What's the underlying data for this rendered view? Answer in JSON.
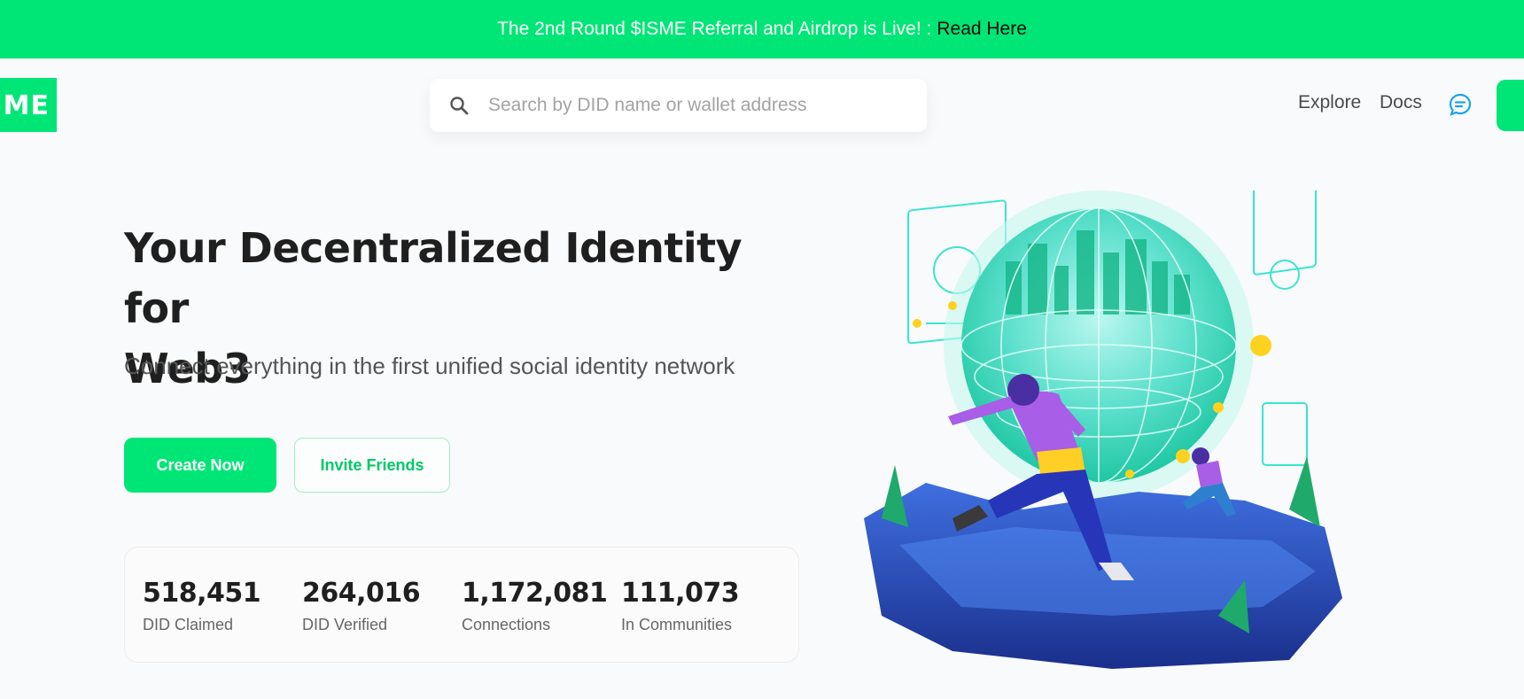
{
  "banner": {
    "text": "The 2nd Round $ISME Referral and Airdrop is Live! :",
    "link": "Read Here"
  },
  "logo": {
    "text": "ME"
  },
  "search": {
    "placeholder": "Search by DID name or wallet address"
  },
  "nav": {
    "explore": "Explore",
    "docs": "Docs"
  },
  "hero": {
    "title_line1": "Your Decentralized Identity for",
    "title_line2": "Web3",
    "subtitle": "Connect everything in the first unified social identity network"
  },
  "buttons": {
    "create": "Create Now",
    "invite": "Invite Friends"
  },
  "stats": [
    {
      "value": "518,451",
      "label": "DID Claimed"
    },
    {
      "value": "264,016",
      "label": "DID Verified"
    },
    {
      "value": "1,172,081",
      "label": "Connections"
    },
    {
      "value": "111,073",
      "label": "In Communities"
    }
  ],
  "colors": {
    "brand": "#00e676",
    "accent_text": "#00c96a"
  },
  "icons": {
    "search": "search-icon",
    "chat": "chat-icon"
  }
}
